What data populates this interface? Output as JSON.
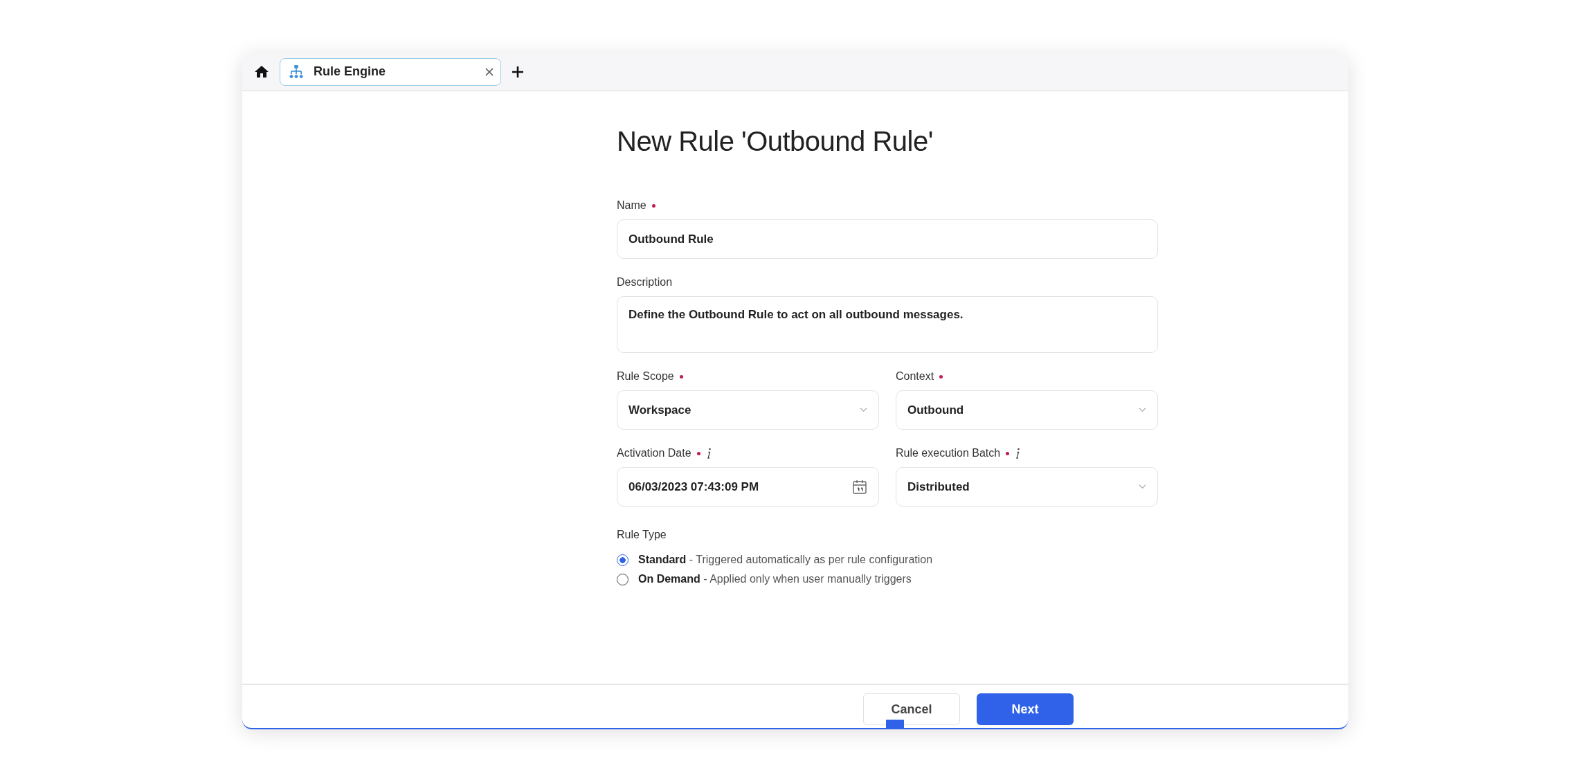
{
  "tabs": [
    {
      "label": "Rule Engine",
      "selected": true
    }
  ],
  "title": "New Rule 'Outbound Rule'",
  "fields": [
    {
      "kind": "text",
      "label": "Name",
      "required": true,
      "info": false,
      "value": "Outbound Rule"
    },
    {
      "kind": "textarea",
      "label": "Description",
      "required": false,
      "info": false,
      "value": "Define the Outbound Rule to act on all outbound messages."
    },
    {
      "kind": "select",
      "label": "Rule Scope",
      "required": true,
      "info": false,
      "value": "Workspace"
    },
    {
      "kind": "select",
      "label": "Context",
      "required": true,
      "info": false,
      "value": "Outbound"
    },
    {
      "kind": "date",
      "label": "Activation Date",
      "required": true,
      "info": true,
      "value": "06/03/2023 07:43:09 PM"
    },
    {
      "kind": "select",
      "label": "Rule execution Batch",
      "required": true,
      "info": true,
      "value": "Distributed"
    }
  ],
  "rule_type": {
    "label": "Rule Type",
    "options": [
      {
        "name": "Standard",
        "description": "- Triggered automatically as per rule configuration",
        "selected": true
      },
      {
        "name": "On Demand",
        "description": "- Applied only when user manually triggers",
        "selected": false
      }
    ]
  },
  "buttons": {
    "cancel": "Cancel",
    "next": "Next"
  }
}
